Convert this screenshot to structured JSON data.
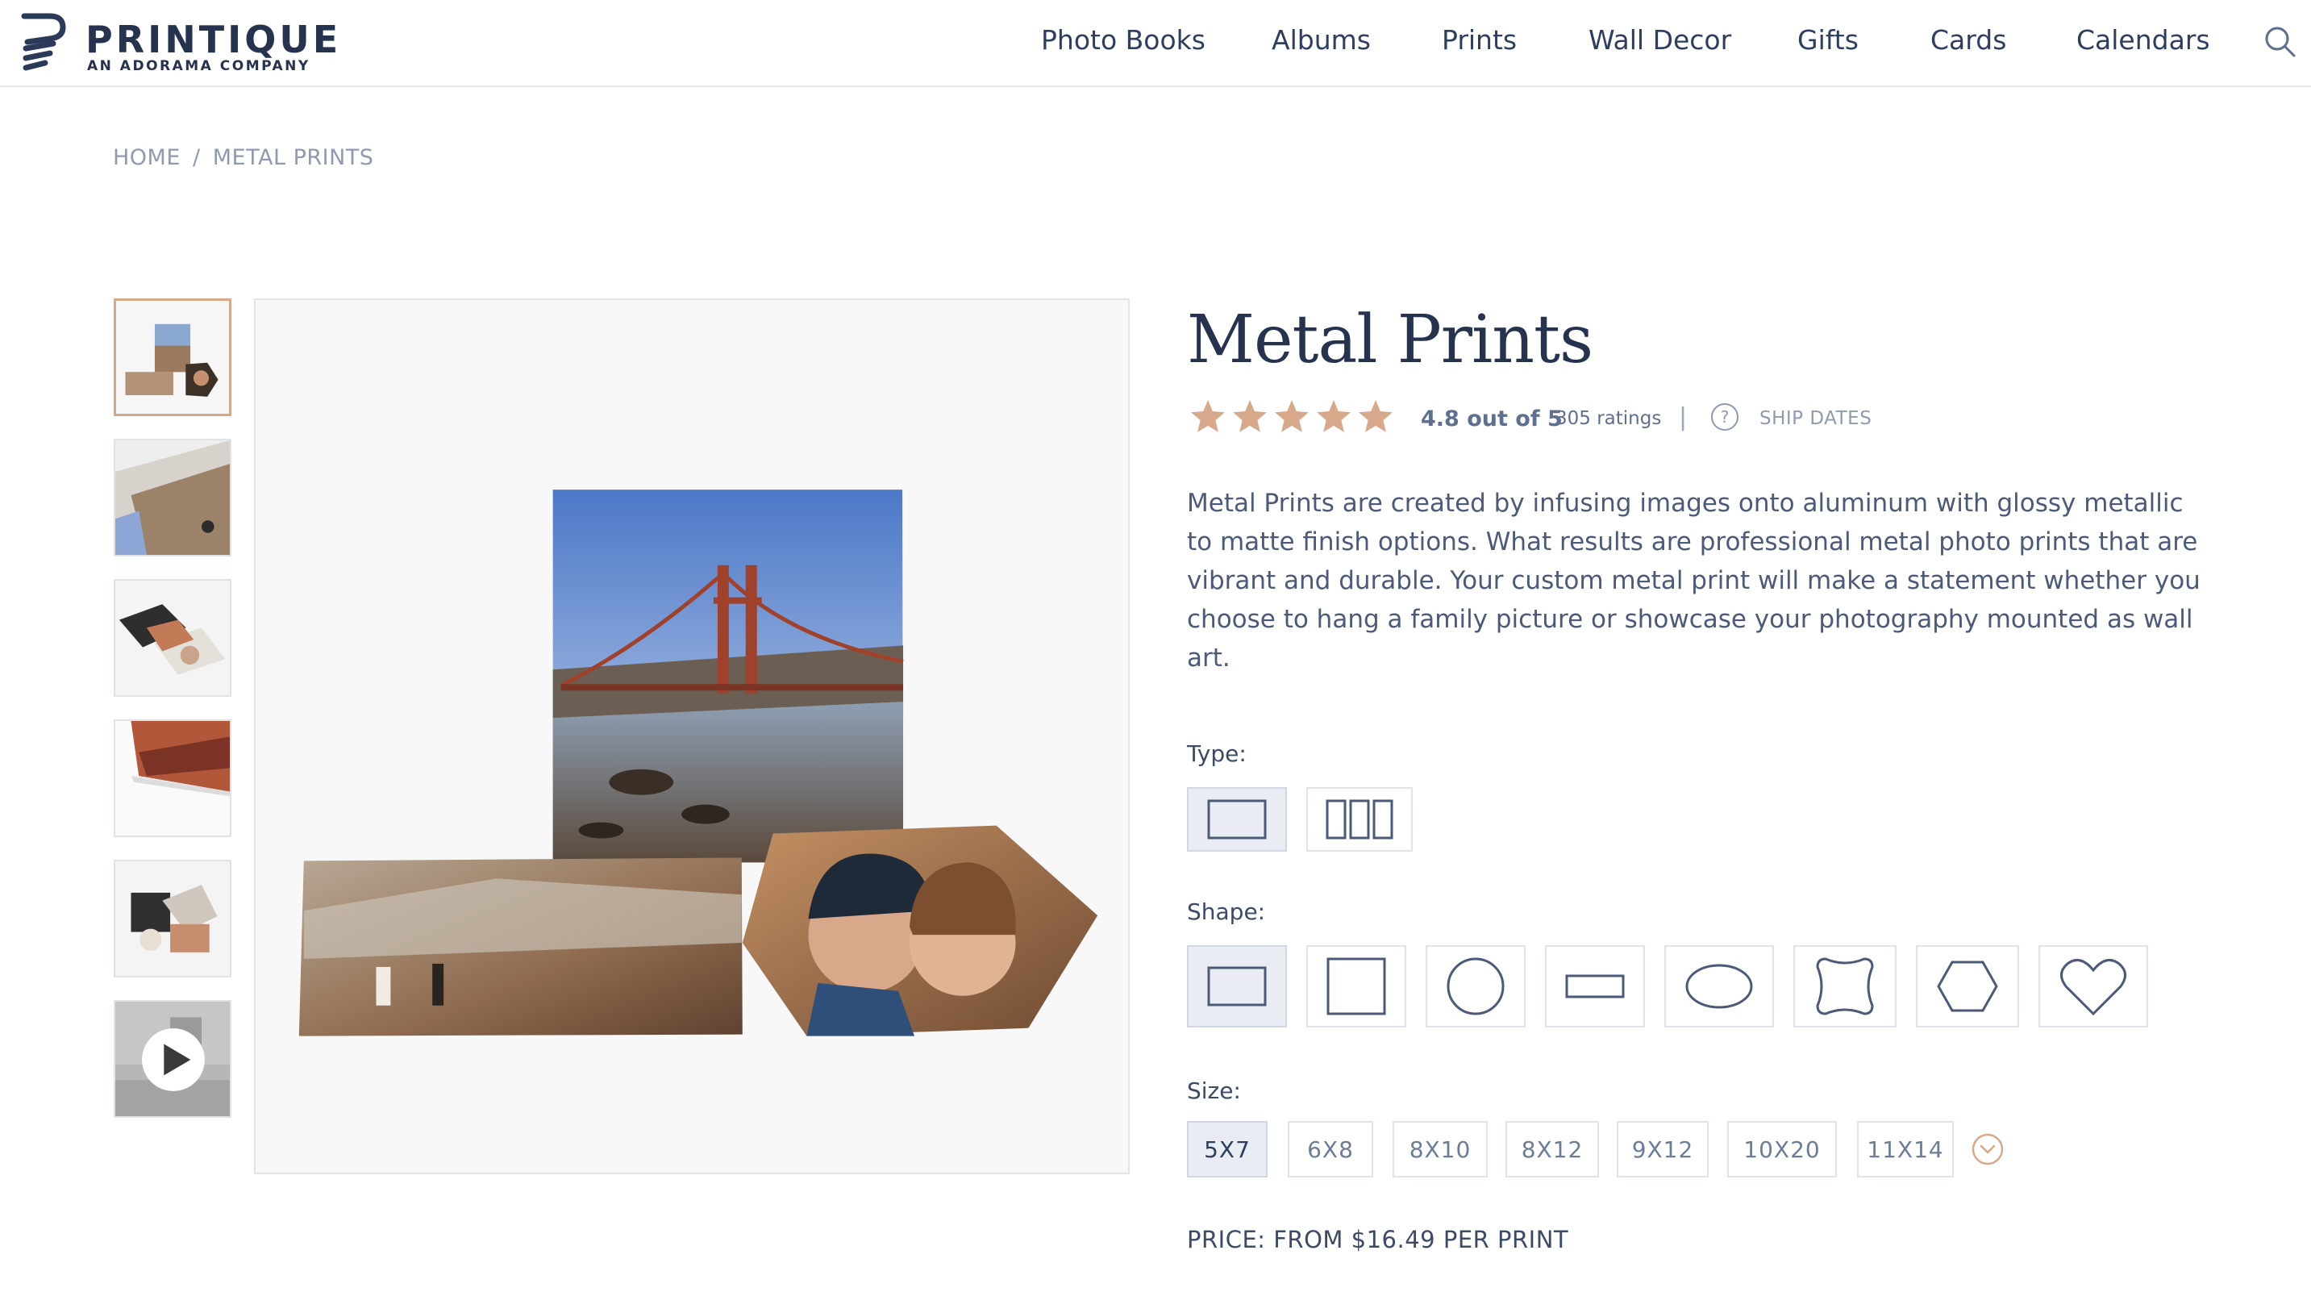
{
  "brand": {
    "name": "PRINTIQUE",
    "tagline": "AN ADORAMA COMPANY"
  },
  "nav": {
    "items": [
      "Photo Books",
      "Albums",
      "Prints",
      "Wall Decor",
      "Gifts",
      "Cards",
      "Calendars"
    ]
  },
  "breadcrumb": {
    "home": "HOME",
    "separator": "/",
    "current": "METAL PRINTS"
  },
  "gallery": {
    "thumbnails": [
      "prints-collage",
      "print-edge-closeup",
      "print-stack",
      "print-standing",
      "prints-display",
      "video"
    ],
    "active_index": 0
  },
  "product": {
    "title": "Metal Prints",
    "rating": {
      "stars": 5,
      "text": "4.8 out of 5",
      "count": "305 ratings",
      "separator": "|"
    },
    "ship_dates": "SHIP DATES",
    "description": "Metal Prints are created by infusing images onto aluminum with glossy metallic to matte finish options. What results are professional metal photo prints that are vibrant and durable. Your custom metal print will make a statement whether you choose to hang a family picture or showcase your photography mounted as wall art."
  },
  "options": {
    "type": {
      "label": "Type:",
      "choices": [
        "single-panel",
        "triptych-panel"
      ],
      "selected": 0
    },
    "shape": {
      "label": "Shape:",
      "choices": [
        "rectangle",
        "square",
        "circle",
        "panoramic",
        "oval",
        "scalloped",
        "hexagon",
        "heart"
      ],
      "selected": 0
    },
    "size": {
      "label": "Size:",
      "choices": [
        "5X7",
        "6X8",
        "8X10",
        "8X12",
        "9X12",
        "10X20",
        "11X14"
      ],
      "selected": 0
    }
  },
  "price": "PRICE: FROM $16.49 PER PRINT",
  "colors": {
    "accent": "#d7a889",
    "navy": "#26334f",
    "text": "#4a5a78",
    "muted": "#8d9ab0",
    "selected_bg": "#e9edf3"
  },
  "icons": {
    "search": "search-icon",
    "help": "help-circle-icon",
    "more": "chevron-down-circle-icon",
    "star": "star-icon",
    "play": "play-icon"
  }
}
